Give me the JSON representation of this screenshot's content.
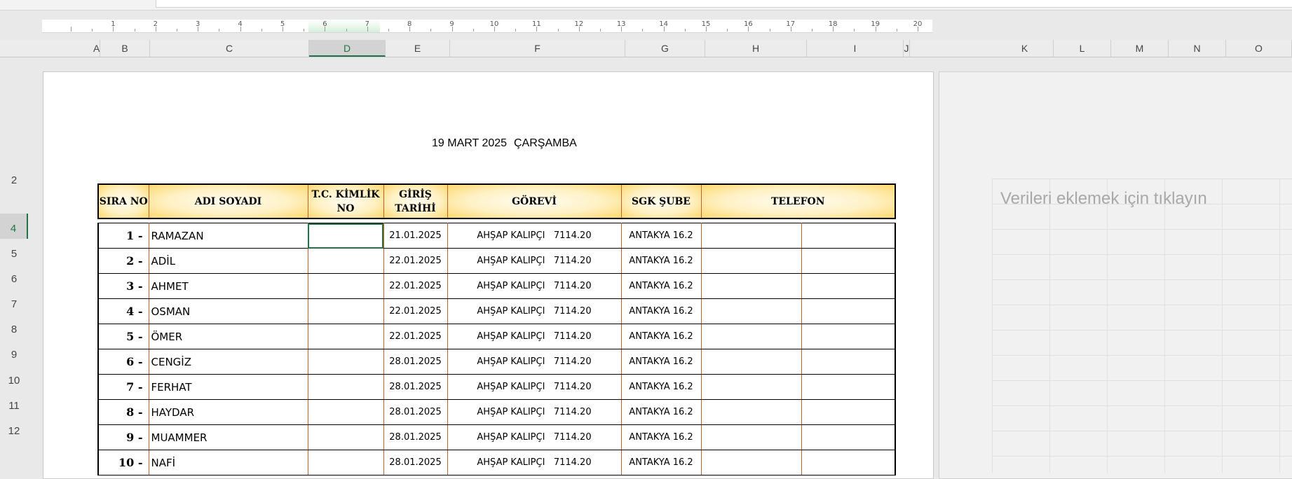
{
  "ruler": {
    "numbers": [
      "1",
      "2",
      "3",
      "4",
      "5",
      "6",
      "7",
      "8",
      "9",
      "10",
      "11",
      "12",
      "13",
      "14",
      "15",
      "16",
      "17",
      "18",
      "19",
      "20"
    ]
  },
  "columns": [
    "A",
    "B",
    "C",
    "D",
    "E",
    "F",
    "G",
    "H",
    "I",
    "J",
    "K",
    "L",
    "M",
    "N",
    "O"
  ],
  "rows": [
    "2",
    "4",
    "5",
    "6",
    "7",
    "8",
    "9",
    "10",
    "11",
    "12"
  ],
  "selected_column": "D",
  "selected_row": "4",
  "title": {
    "date": "19 MART 2025",
    "day": "ÇARŞAMBA"
  },
  "headers": {
    "sira_no": "SIRA NO",
    "adi_soyadi": "ADI SOYADI",
    "tc_kimlik_no": "T.C. KİMLİK NO",
    "giris_tarihi": "GİRİŞ TARİHİ",
    "gorevi": "GÖREVİ",
    "sgk_sube": "SGK ŞUBE",
    "telefon": "TELEFON"
  },
  "employees": [
    {
      "no": "1 -",
      "name": "RAMAZAN",
      "tc": "",
      "date": "21.01.2025",
      "job": "AHŞAP KALIPÇI   7114.20",
      "sgk": "ANTAKYA 16.2"
    },
    {
      "no": "2 -",
      "name": "ADİL",
      "tc": "",
      "date": "22.01.2025",
      "job": "AHŞAP KALIPÇI   7114.20",
      "sgk": "ANTAKYA 16.2"
    },
    {
      "no": "3 -",
      "name": "AHMET",
      "tc": "",
      "date": "22.01.2025",
      "job": "AHŞAP KALIPÇI   7114.20",
      "sgk": "ANTAKYA 16.2"
    },
    {
      "no": "4 -",
      "name": "OSMAN",
      "tc": "",
      "date": "22.01.2025",
      "job": "AHŞAP KALIPÇI   7114.20",
      "sgk": "ANTAKYA 16.2"
    },
    {
      "no": "5 -",
      "name": "ÖMER",
      "tc": "",
      "date": "22.01.2025",
      "job": "AHŞAP KALIPÇI   7114.20",
      "sgk": "ANTAKYA 16.2"
    },
    {
      "no": "6 -",
      "name": "CENGİZ",
      "tc": "",
      "date": "28.01.2025",
      "job": "AHŞAP KALIPÇI   7114.20",
      "sgk": "ANTAKYA 16.2"
    },
    {
      "no": "7 -",
      "name": "FERHAT",
      "tc": "",
      "date": "28.01.2025",
      "job": "AHŞAP KALIPÇI   7114.20",
      "sgk": "ANTAKYA 16.2"
    },
    {
      "no": "8 -",
      "name": "HAYDAR",
      "tc": "",
      "date": "28.01.2025",
      "job": "AHŞAP KALIPÇI   7114.20",
      "sgk": "ANTAKYA 16.2"
    },
    {
      "no": "9 -",
      "name": "MUAMMER",
      "tc": "",
      "date": "28.01.2025",
      "job": "AHŞAP KALIPÇI   7114.20",
      "sgk": "ANTAKYA 16.2"
    },
    {
      "no": "10 -",
      "name": "NAFİ",
      "tc": "",
      "date": "28.01.2025",
      "job": "AHŞAP KALIPÇI   7114.20",
      "sgk": "ANTAKYA 16.2"
    }
  ],
  "side_panel": {
    "placeholder": "Verileri eklemek için tıklayın"
  }
}
